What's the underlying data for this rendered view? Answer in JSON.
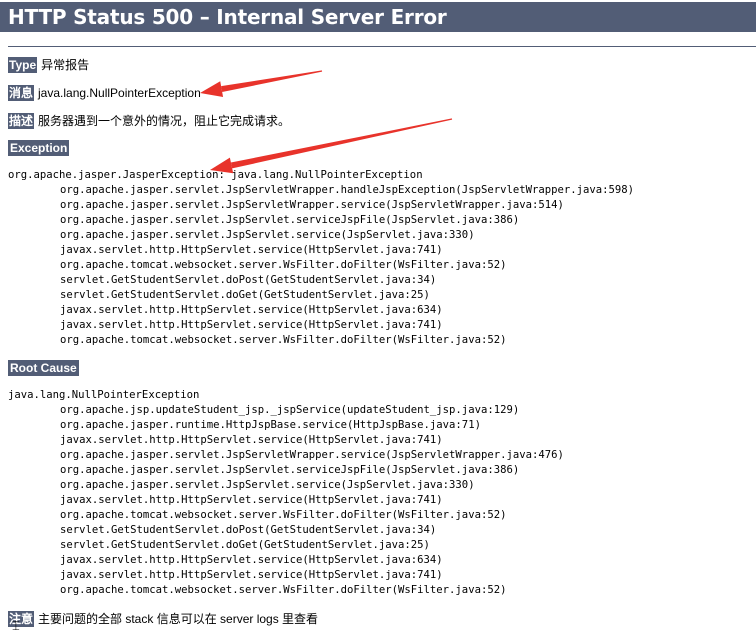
{
  "page": {
    "title": "HTTP Status 500 – Internal Server Error"
  },
  "type_row": {
    "label": "Type",
    "value": "异常报告"
  },
  "message_row": {
    "label": "消息",
    "value": "java.lang.NullPointerException"
  },
  "description_row": {
    "label": "描述",
    "value": "服务器遇到一个意外的情况，阻止它完成请求。"
  },
  "exception": {
    "heading": "Exception",
    "lines": [
      {
        "text": "org.apache.jasper.JasperException: java.lang.NullPointerException",
        "indent": false
      },
      {
        "text": "org.apache.jasper.servlet.JspServletWrapper.handleJspException(JspServletWrapper.java:598)",
        "indent": true
      },
      {
        "text": "org.apache.jasper.servlet.JspServletWrapper.service(JspServletWrapper.java:514)",
        "indent": true
      },
      {
        "text": "org.apache.jasper.servlet.JspServlet.serviceJspFile(JspServlet.java:386)",
        "indent": true
      },
      {
        "text": "org.apache.jasper.servlet.JspServlet.service(JspServlet.java:330)",
        "indent": true
      },
      {
        "text": "javax.servlet.http.HttpServlet.service(HttpServlet.java:741)",
        "indent": true
      },
      {
        "text": "org.apache.tomcat.websocket.server.WsFilter.doFilter(WsFilter.java:52)",
        "indent": true
      },
      {
        "text": "servlet.GetStudentServlet.doPost(GetStudentServlet.java:34)",
        "indent": true
      },
      {
        "text": "servlet.GetStudentServlet.doGet(GetStudentServlet.java:25)",
        "indent": true
      },
      {
        "text": "javax.servlet.http.HttpServlet.service(HttpServlet.java:634)",
        "indent": true
      },
      {
        "text": "javax.servlet.http.HttpServlet.service(HttpServlet.java:741)",
        "indent": true
      },
      {
        "text": "org.apache.tomcat.websocket.server.WsFilter.doFilter(WsFilter.java:52)",
        "indent": true
      }
    ]
  },
  "root_cause": {
    "heading": "Root Cause",
    "lines": [
      {
        "text": "java.lang.NullPointerException",
        "indent": false
      },
      {
        "text": "org.apache.jsp.updateStudent_jsp._jspService(updateStudent_jsp.java:129)",
        "indent": true
      },
      {
        "text": "org.apache.jasper.runtime.HttpJspBase.service(HttpJspBase.java:71)",
        "indent": true
      },
      {
        "text": "javax.servlet.http.HttpServlet.service(HttpServlet.java:741)",
        "indent": true
      },
      {
        "text": "org.apache.jasper.servlet.JspServletWrapper.service(JspServletWrapper.java:476)",
        "indent": true
      },
      {
        "text": "org.apache.jasper.servlet.JspServlet.serviceJspFile(JspServlet.java:386)",
        "indent": true
      },
      {
        "text": "org.apache.jasper.servlet.JspServlet.service(JspServlet.java:330)",
        "indent": true
      },
      {
        "text": "javax.servlet.http.HttpServlet.service(HttpServlet.java:741)",
        "indent": true
      },
      {
        "text": "org.apache.tomcat.websocket.server.WsFilter.doFilter(WsFilter.java:52)",
        "indent": true
      },
      {
        "text": "servlet.GetStudentServlet.doPost(GetStudentServlet.java:34)",
        "indent": true
      },
      {
        "text": "servlet.GetStudentServlet.doGet(GetStudentServlet.java:25)",
        "indent": true
      },
      {
        "text": "javax.servlet.http.HttpServlet.service(HttpServlet.java:634)",
        "indent": true
      },
      {
        "text": "javax.servlet.http.HttpServlet.service(HttpServlet.java:741)",
        "indent": true
      },
      {
        "text": "org.apache.tomcat.websocket.server.WsFilter.doFilter(WsFilter.java:52)",
        "indent": true
      }
    ]
  },
  "note_row": {
    "label": "注意",
    "value": "主要问题的全部 stack 信息可以在 server logs 里查看"
  },
  "annotations": {
    "arrow_color": "#e8332b"
  },
  "theme": {
    "header_bg": "#525d76",
    "header_text": "#ffffff"
  }
}
